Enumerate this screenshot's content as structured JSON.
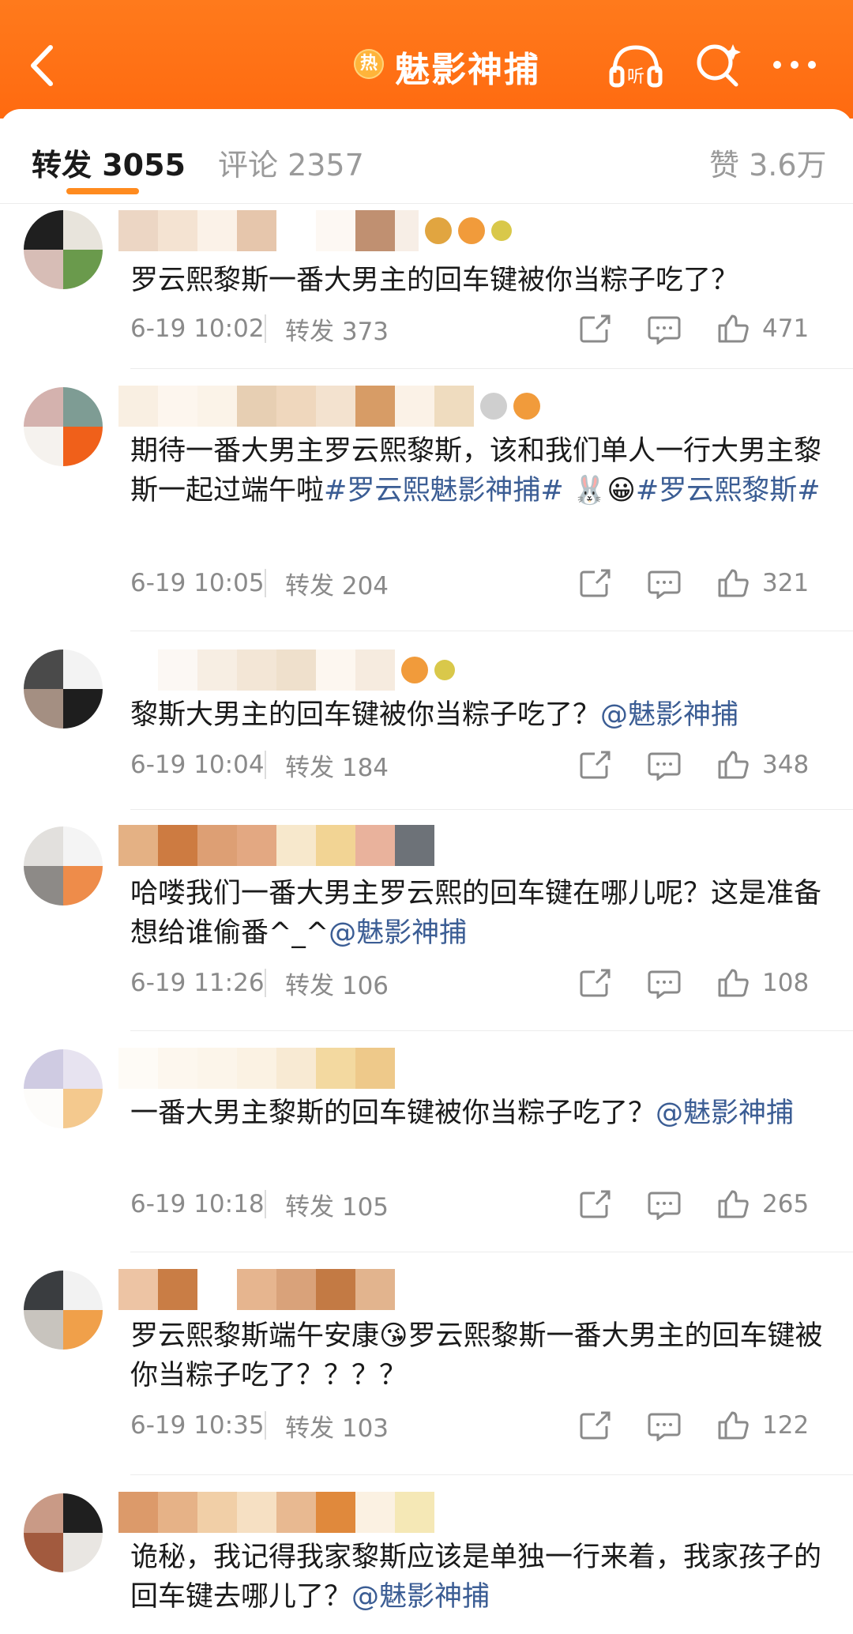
{
  "header": {
    "title": "魅影神捕",
    "hot_label": "热",
    "listen_label": "听",
    "icons": [
      "back-icon",
      "listen-icon",
      "search-icon",
      "more-icon"
    ],
    "accent_color": "#ff6a10"
  },
  "tabs": {
    "repost": "转发 3055",
    "comment": "评论 2357",
    "like": "赞 3.6万"
  },
  "comments": [
    {
      "text": "罗云熙黎斯一番大男主的回车键被你当粽子吃了？",
      "date": "6-19 10:02",
      "repost": "转发 373",
      "likes": "471"
    },
    {
      "text_parts": [
        "期待一番大男主罗云熙黎斯，该和我们单人一行大男主黎斯一起过端午啦",
        "#罗云熙魅影神捕#",
        " 🐰😀",
        "#罗云熙黎斯#"
      ],
      "date": "6-19 10:05",
      "repost": "转发 204",
      "likes": "321"
    },
    {
      "text_parts": [
        "黎斯大男主的回车键被你当粽子吃了？",
        "@魅影神捕"
      ],
      "date": "6-19 10:04",
      "repost": "转发 184",
      "likes": "348"
    },
    {
      "text_parts": [
        "哈喽我们一番大男主罗云熙的回车键在哪儿呢？这是准备想给谁偷番^_^",
        "@魅影神捕"
      ],
      "date": "6-19 11:26",
      "repost": "转发 106",
      "likes": "108"
    },
    {
      "text_parts": [
        "一番大男主黎斯的回车键被你当粽子吃了？",
        "@魅影神捕"
      ],
      "date": "6-19 10:18",
      "repost": "转发 105",
      "likes": "265"
    },
    {
      "text": "罗云熙黎斯端午安康😘罗云熙黎斯一番大男主的回车键被你当粽子吃了？？？？",
      "date": "6-19 10:35",
      "repost": "转发 103",
      "likes": "122"
    },
    {
      "text_parts": [
        "诡秘，我记得我家黎斯应该是单独一行来着，我家孩子的回车键去哪儿了？",
        "@魅影神捕"
      ]
    }
  ]
}
